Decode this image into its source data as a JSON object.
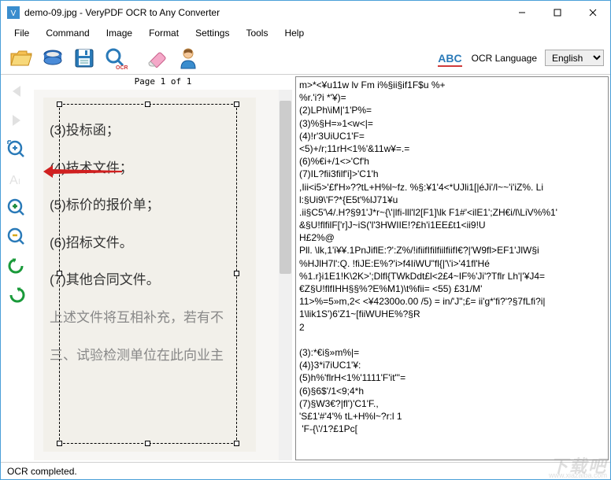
{
  "window": {
    "title": "demo-09.jpg - VeryPDF OCR to Any Converter"
  },
  "menu": {
    "file": "File",
    "command": "Command",
    "image": "Image",
    "format": "Format",
    "settings": "Settings",
    "tools": "Tools",
    "help": "Help"
  },
  "toolbar": {
    "ocr_lang_label": "OCR Language",
    "lang_value": "English"
  },
  "page_label": "Page 1 of 1",
  "doc_lines": {
    "l1": "(3)投标函；",
    "l2": "(4)技术文件；",
    "l3": "(5)标价的报价单；",
    "l4": "(6)招标文件。",
    "l5": "(7)其他合同文件。",
    "l6": "上述文件将互相补充，若有不",
    "l7": "三、试验检测单位在此向业主"
  },
  "ocr_text": "m>*<¥u11w lv Fm i%§ii§if1F$u %+\n%r.'i?i *'¥)=\n(2)LPh\\iM|'1'P%=\n(3)%§H=»1<w<|=\n(4)!r'3UiUC1'F=\n<5)+/r;11rH<1%'&11w¥=.=\n(6)%€i+/1<>'Cf'h\n(7)IL?fii3filf'i]>'C1'h\n,Iii<i5>'£f'H»??tL+H%l~fz. %§:¥1'4<*UJli1[|éJi'/l~~'i'iZ%. Li\nl:§Ui9\\'F?*{E5t'%lJ71¥u\n.ii§C5'\\4/.H?§91'J*r~{\\'|lfi-lll'l2[F1]\\lk F1#'<ilE1';ZH€i/l\\LiV%%1'\n&§U!flfilF['r]J~iS('l'3HWIIE!?£h'i1EE£t1<ii9!U\nH£2%@\nPll. \\lk,1'i¥¥.1PnJiflE:?':Z%/!ifiifIfilfiilfiifI€?|'W9fl>EF1'JlW§i\n%HJlH7l':Q. !fiJE:E%?'i>f4IiWU\"fl{|'\\'i>'41fl'Hé\n%1.r}i1E1!K\\2K>';Dlfl{TWkDdt£l<2£4~IF%'Ji'?Tflr Lh'|'¥J4=\n€Z§U!flfIHH§§%?E%M1)\\t%fii= <55) £31/M'\n11>%=5»m,2< <¥42300o.00 /5) = in/'J\";£= ii'g*'fi?'?§7fLfi?i|\n1\\lik1S')6'Z1~[fiiWUHE%?§R\n2\n\n(3):*€i§»m%|=\n(4)}3*i7iUC1'¥:\n(5)h%'flrH<1%'1111'F'it\"'=\n(6)§6$'/1<9;4*h\n(7)§W3€?|fl')'C1'F.,\n'S£1'#'4'% tL+H%l~?r:l 1\n 'F-{\\'/1?£1Pc[",
  "status": "OCR completed.",
  "watermark": {
    "main": "下载吧",
    "sub": "www.xiazaiba.com"
  }
}
